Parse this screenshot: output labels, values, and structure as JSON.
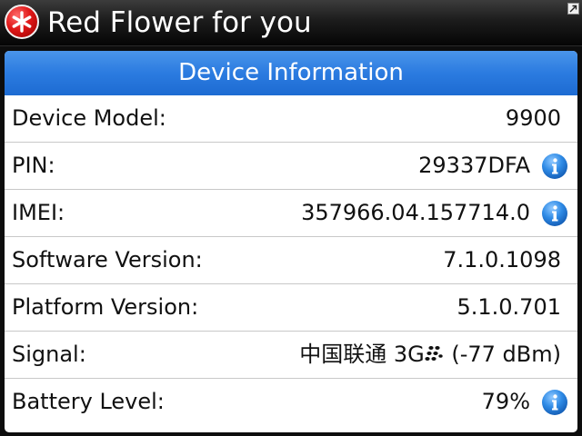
{
  "app": {
    "title": "Red Flower for you",
    "icon": "red-flower-icon"
  },
  "panel": {
    "title": "Device Information",
    "rows": [
      {
        "label": "Device Model:",
        "value": "9900",
        "info": false
      },
      {
        "label": "PIN:",
        "value": "29337DFA",
        "info": true
      },
      {
        "label": "IMEI:",
        "value": "357966.04.157714.0",
        "info": true
      },
      {
        "label": "Software Version:",
        "value": "7.1.0.1098",
        "info": false
      },
      {
        "label": "Platform Version:",
        "value": "5.1.0.701",
        "info": false
      },
      {
        "label": "Signal:",
        "value_carrier": "中国联通 3G",
        "value_strength": "(-77 dBm)",
        "info": false
      },
      {
        "label": "Battery Level:",
        "value": "79%",
        "info": true
      }
    ]
  },
  "colors": {
    "header_blue": "#2b7be0",
    "info_blue": "#2f8be6",
    "icon_red": "#e01818"
  }
}
